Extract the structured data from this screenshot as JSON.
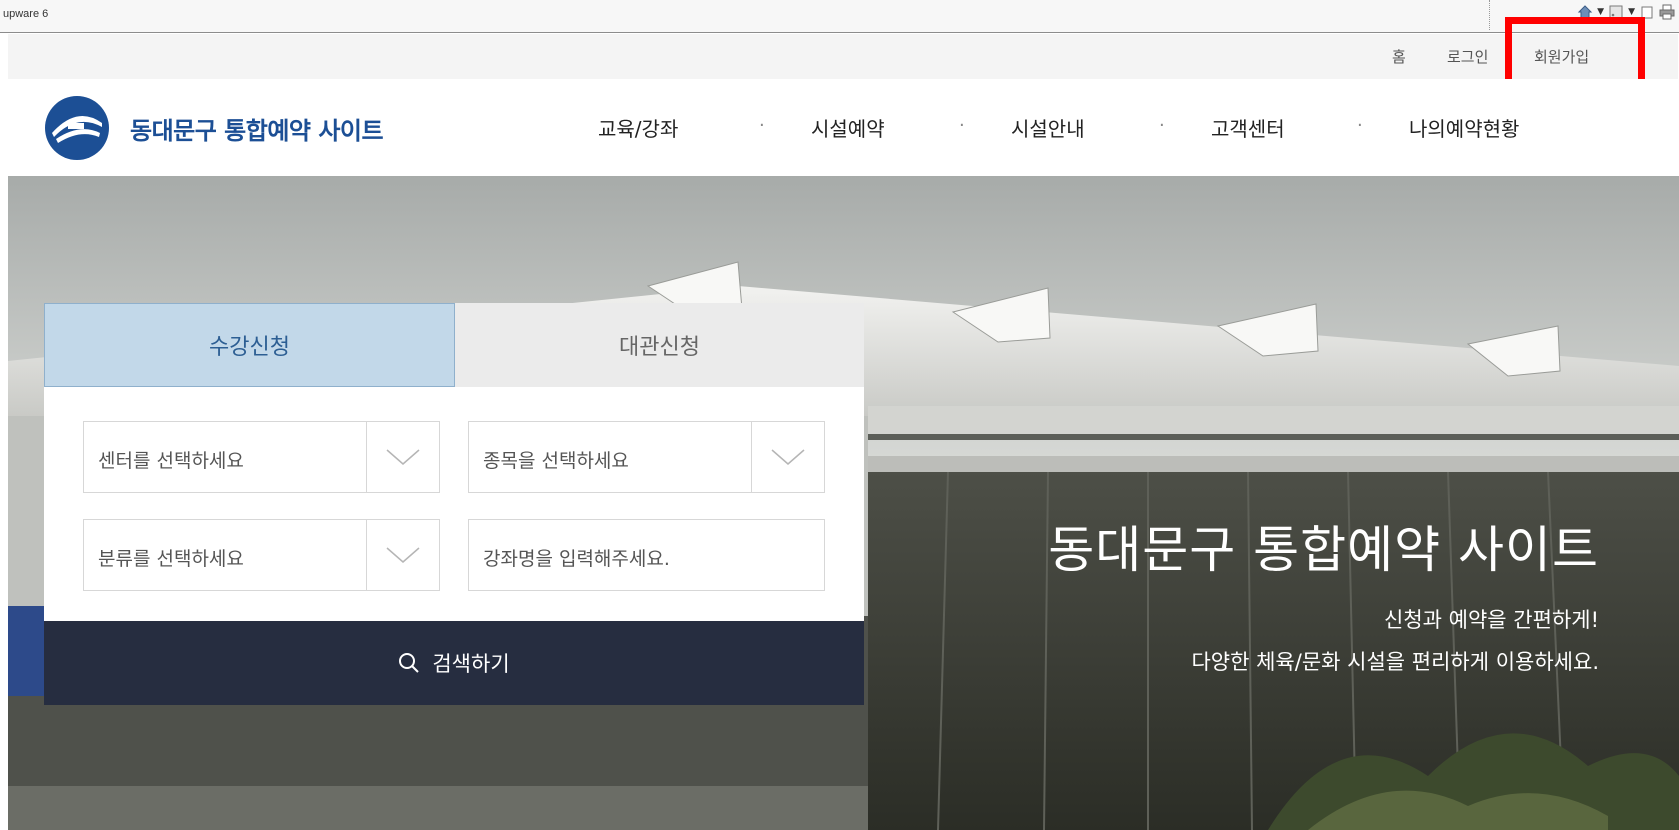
{
  "browser": {
    "title": "upware 6",
    "icons": [
      "home-icon",
      "feed-icon",
      "page-icon",
      "print-icon"
    ]
  },
  "utility": {
    "home": "홈",
    "login": "로그인",
    "join": "회원가입"
  },
  "annotation": {
    "color": "#ff0000"
  },
  "header": {
    "logo_text": "동대문구 통합예약 사이트",
    "nav": [
      "교육/강좌",
      "시설예약",
      "시설안내",
      "고객센터",
      "나의예약현황"
    ],
    "separator": "·"
  },
  "search": {
    "tabs": [
      "수강신청",
      "대관신청"
    ],
    "center_select": "센터를 선택하세요",
    "sport_select": "종목을 선택하세요",
    "category_select": "분류를 선택하세요",
    "course_input_placeholder": "강좌명을 입력해주세요.",
    "button_label": "검색하기"
  },
  "hero": {
    "title": "동대문구 통합예약 사이트",
    "subtitle_1": "신청과 예약을 간편하게!",
    "subtitle_2": "다양한 체육/문화 시설을 편리하게 이용하세요."
  },
  "colors": {
    "brand": "#1c4f95",
    "tab_active_bg": "#c2d8e9",
    "search_button": "#262d40"
  }
}
